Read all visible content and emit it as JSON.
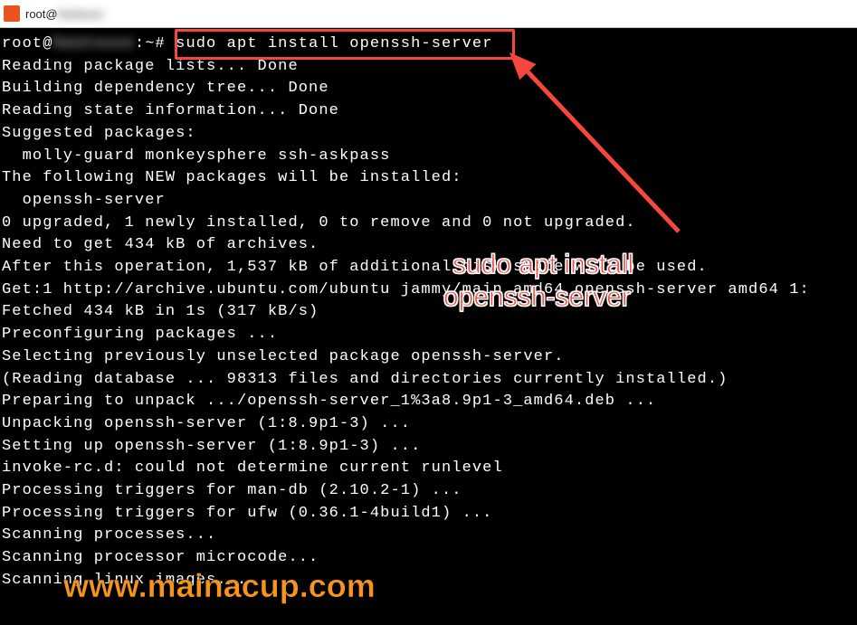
{
  "titlebar": {
    "icon_label": "ub",
    "title": "root@"
  },
  "terminal": {
    "prompt_user": "root@",
    "prompt_suffix": ":~#",
    "command": "sudo apt install openssh-server",
    "lines": [
      "Reading package lists... Done",
      "Building dependency tree... Done",
      "Reading state information... Done",
      "Suggested packages:",
      "  molly-guard monkeysphere ssh-askpass",
      "The following NEW packages will be installed:",
      "  openssh-server",
      "0 upgraded, 1 newly installed, 0 to remove and 0 not upgraded.",
      "Need to get 434 kB of archives.",
      "After this operation, 1,537 kB of additional disk space will be used.",
      "Get:1 http://archive.ubuntu.com/ubuntu jammy/main amd64 openssh-server amd64 1:",
      "Fetched 434 kB in 1s (317 kB/s)",
      "Preconfiguring packages ...",
      "Selecting previously unselected package openssh-server.",
      "(Reading database ... 98313 files and directories currently installed.)",
      "Preparing to unpack .../openssh-server_1%3a8.9p1-3_amd64.deb ...",
      "Unpacking openssh-server (1:8.9p1-3) ...",
      "Setting up openssh-server (1:8.9p1-3) ...",
      "invoke-rc.d: could not determine current runlevel",
      "Processing triggers for man-db (2.10.2-1) ...",
      "Processing triggers for ufw (0.36.1-4build1) ...",
      "Scanning processes...",
      "Scanning processor microcode...",
      "Scanning linux images..."
    ]
  },
  "annotation": {
    "line1": "sudo apt install",
    "line2": "openssh-server"
  },
  "watermark": "www.mainacup.com",
  "colors": {
    "terminal_bg": "#000000",
    "terminal_fg": "#ffffff",
    "highlight": "#f6473e",
    "watermark": "#f7941d",
    "ubuntu": "#e95420"
  }
}
